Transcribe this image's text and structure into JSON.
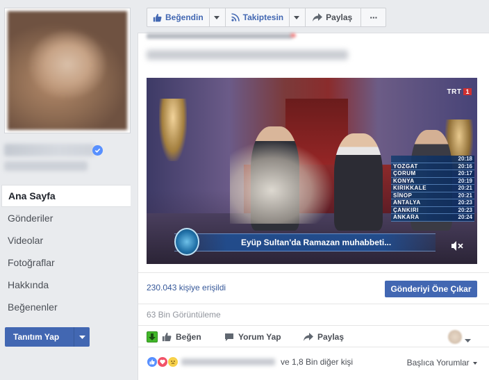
{
  "sidebar": {
    "nav": [
      {
        "label": "Ana Sayfa",
        "active": true
      },
      {
        "label": "Gönderiler",
        "active": false
      },
      {
        "label": "Videolar",
        "active": false
      },
      {
        "label": "Fotoğraflar",
        "active": false
      },
      {
        "label": "Hakkında",
        "active": false
      },
      {
        "label": "Beğenenler",
        "active": false
      }
    ],
    "promote_label": "Tanıtım Yap"
  },
  "action_bar": {
    "like_label": "Beğendin",
    "follow_label": "Takiptesin",
    "share_label": "Paylaş",
    "more_label": "···"
  },
  "video": {
    "channel_logo": "TRT",
    "caption": "Eyüp Sultan'da Ramazan muhabbeti...",
    "ticker": [
      {
        "city": "",
        "time": "20:18"
      },
      {
        "city": "YOZGAT",
        "time": "20:16"
      },
      {
        "city": "ÇORUM",
        "time": "20:17"
      },
      {
        "city": "KONYA",
        "time": "20:19"
      },
      {
        "city": "KIRIKKALE",
        "time": "20:21"
      },
      {
        "city": "SİNOP",
        "time": "20:21"
      },
      {
        "city": "ANTALYA",
        "time": "20:23"
      },
      {
        "city": "ÇANKIRI",
        "time": "20:23"
      },
      {
        "city": "ANKARA",
        "time": "20:24"
      }
    ]
  },
  "stats": {
    "reach_text": "230.043 kişiye erişildi",
    "boost_label": "Gönderiyi Öne Çıkar",
    "views_text": "63 Bin Görüntüleme"
  },
  "interactions": {
    "like_label": "Beğen",
    "comment_label": "Yorum Yap",
    "share_label": "Paylaş"
  },
  "reactions": {
    "others_text": "ve 1,8 Bin diğer kişi",
    "sort_label": "Başlıca Yorumlar"
  },
  "colors": {
    "brand_blue": "#4267b2",
    "link_blue": "#365899",
    "page_bg": "#e9ebee"
  }
}
